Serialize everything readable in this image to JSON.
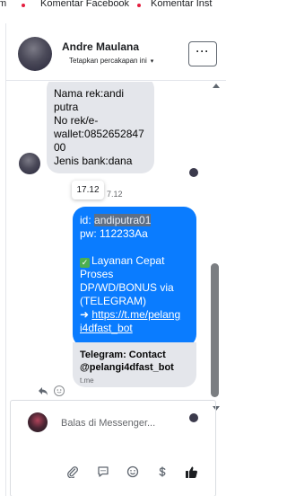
{
  "tabs": [
    {
      "label": "m"
    },
    {
      "label": "Komentar Facebook"
    },
    {
      "label": "Komentar Inst"
    }
  ],
  "header": {
    "name": "Andre Maulana",
    "subtitle": "Tetapkan percakapan ini",
    "subtitle_caret": "▾",
    "more_label": "···"
  },
  "incoming_message": {
    "lines": [
      "Nama rek:andi",
      "putra",
      "No rek/e-",
      "wallet:0852652847",
      "00",
      "Jenis bank:dana"
    ]
  },
  "tooltip": {
    "time": "17.12",
    "behind_time": "7.12"
  },
  "outgoing_message": {
    "id_label": "id: ",
    "id_value": "andiputra01",
    "pw_line": "pw: 112233Aa",
    "promo_line1": "Layanan Cepat",
    "promo_line2": "Proses",
    "promo_line3": "DP/WD/BONUS via",
    "promo_line4": "(TELEGRAM)",
    "arrow": "➜ ",
    "link_line1": "https://t.me/pelang",
    "link_line2": "i4dfast_bot",
    "check_glyph": "✓"
  },
  "link_preview": {
    "title": "Telegram: Contact @pelangi4dfast_bot",
    "domain": "t.me"
  },
  "composer": {
    "placeholder": "Balas di Messenger..."
  },
  "icons": {
    "reply": "reply-icon",
    "reaction": "smiley-icon",
    "attachment": "paperclip-icon",
    "saved_replies": "chat-bubble-icon",
    "emoji": "emoji-icon",
    "payment": "dollar-icon",
    "like": "thumbs-up-icon"
  },
  "colors": {
    "outgoing_bubble": "#0a7cff",
    "incoming_bubble": "#e4e6eb",
    "highlight": "#5e6f85"
  }
}
